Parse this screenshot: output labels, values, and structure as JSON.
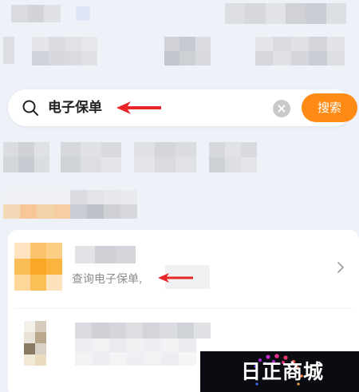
{
  "search": {
    "query": "电子保单",
    "button_label": "搜索"
  },
  "result": {
    "subtitle": "查询电子保单,"
  },
  "watermark": {
    "text": "日正商城"
  },
  "colors": {
    "accent": "#ff8a14",
    "arrow": "#e8262a",
    "background": "#eef1f7"
  },
  "icons": [
    "search-icon",
    "clear-icon",
    "chevron-right-icon",
    "arrow-icon"
  ]
}
